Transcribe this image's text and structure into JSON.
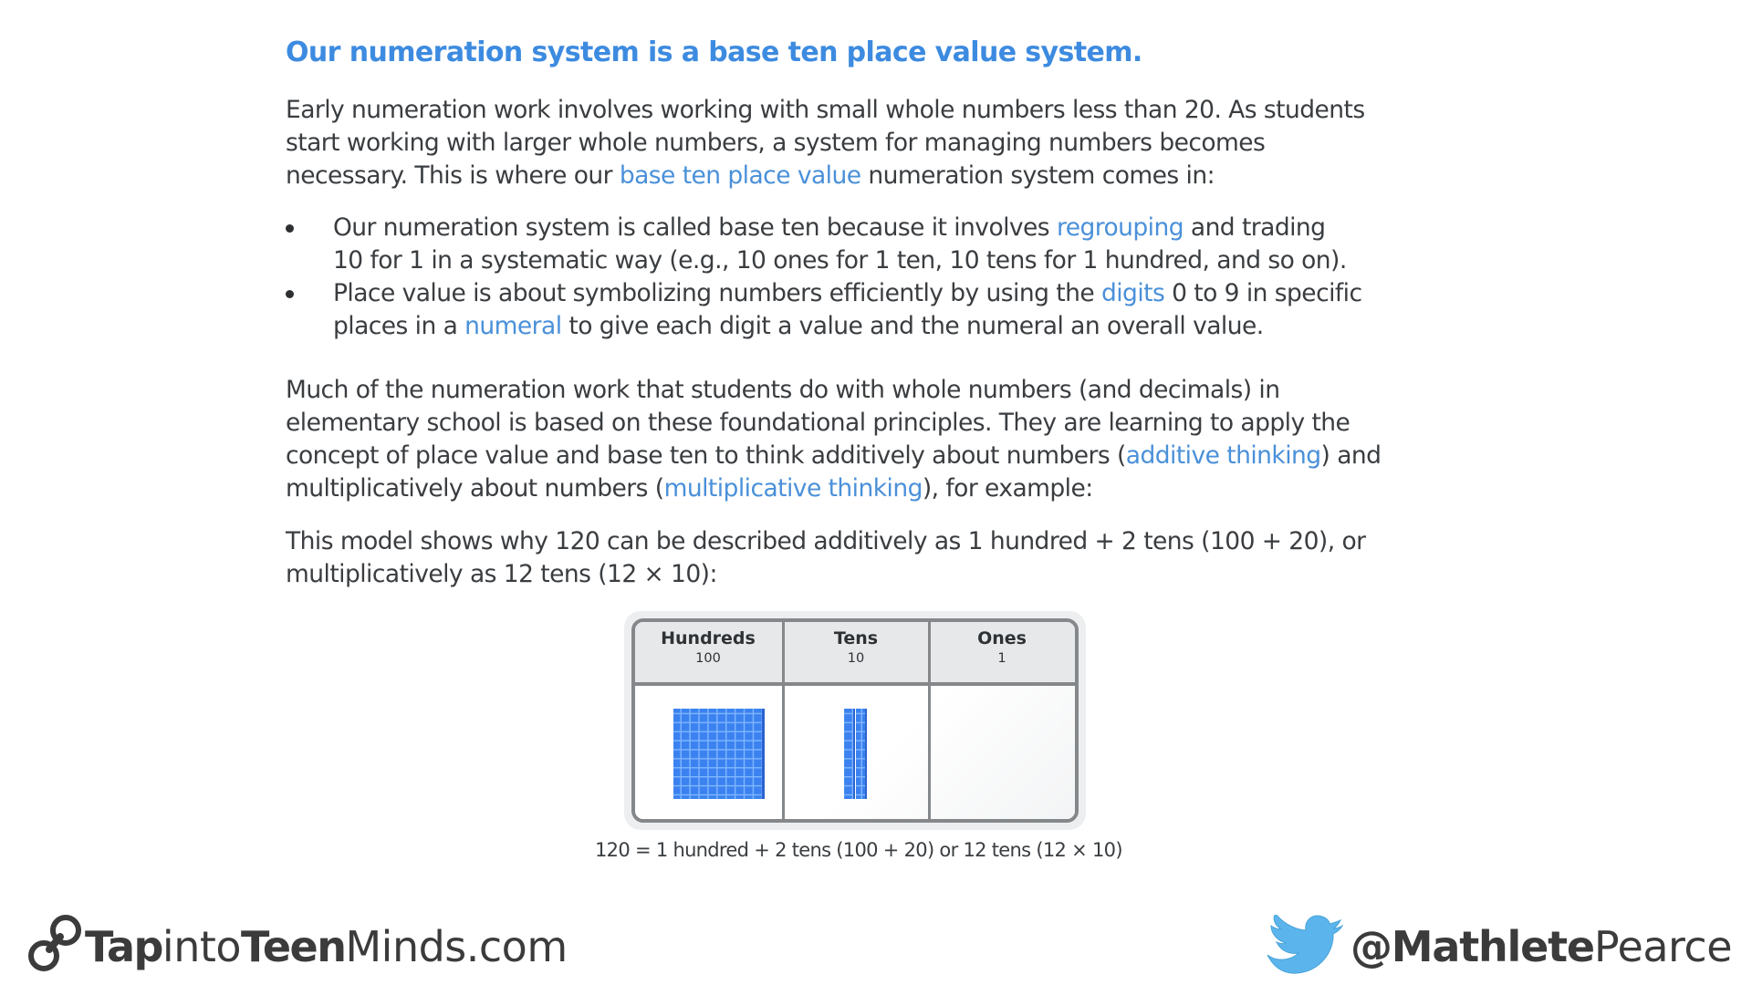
{
  "title": "Our numeration system is a base ten place value system.",
  "colors": {
    "accent": "#3d8be0",
    "link": "#4a90d9",
    "text": "#3a3d40",
    "block_blue": "#3b82f0",
    "twitter": "#5bb5ec"
  },
  "paragraph1": [
    [
      {
        "t": "Early numeration work involves working with small whole numbers less than 20. As students"
      }
    ],
    [
      {
        "t": "start working with larger whole numbers, a system for managing numbers becomes"
      }
    ],
    [
      {
        "t": "necessary. This is where our "
      },
      {
        "t": "base ten place value",
        "link": true
      },
      {
        "t": " numeration system comes in:"
      }
    ]
  ],
  "bullets": [
    [
      [
        {
          "t": "Our numeration system is called base ten because it involves "
        },
        {
          "t": "regrouping",
          "link": true
        },
        {
          "t": " and trading"
        }
      ],
      [
        {
          "t": "10 for 1 in a systematic way (e.g., 10 ones for 1 ten, 10 tens for 1 hundred, and so on)."
        }
      ]
    ],
    [
      [
        {
          "t": "Place value is about symbolizing numbers efficiently by using the "
        },
        {
          "t": "digits",
          "link": true
        },
        {
          "t": " 0 to 9 in specific"
        }
      ],
      [
        {
          "t": "places in a "
        },
        {
          "t": "numeral",
          "link": true
        },
        {
          "t": " to give each digit a value and the numeral an overall value."
        }
      ]
    ]
  ],
  "paragraph2": [
    [
      {
        "t": "Much of the numeration work that students do with whole numbers (and decimals) in"
      }
    ],
    [
      {
        "t": "elementary school is based on these foundational principles. They are learning to apply the"
      }
    ],
    [
      {
        "t": "concept of place value and base ten to think additively about numbers ("
      },
      {
        "t": "additive thinking",
        "link": true
      },
      {
        "t": ") and"
      }
    ],
    [
      {
        "t": "multiplicatively about numbers ("
      },
      {
        "t": "multiplicative thinking",
        "link": true
      },
      {
        "t": "), for example:"
      }
    ]
  ],
  "paragraph3": [
    [
      {
        "t": "This model shows why 120 can be described additively as 1 hundred + 2 tens (100 + 20), or"
      }
    ],
    [
      {
        "t": "multiplicatively as 12 tens (12 × 10):"
      }
    ]
  ],
  "place_value_table": {
    "columns": [
      {
        "name": "Hundreds",
        "value": "100",
        "blocks": 1
      },
      {
        "name": "Tens",
        "value": "10",
        "blocks": 2
      },
      {
        "name": "Ones",
        "value": "1",
        "blocks": 0
      }
    ],
    "caption": "120 = 1 hundred + 2 tens (100 + 20) or 12 tens (12 × 10)"
  },
  "footer": {
    "logo_icon": "chain-link-icon",
    "logo_parts": [
      {
        "t": "Tap",
        "bold": true
      },
      {
        "t": "into",
        "bold": false
      },
      {
        "t": "Teen",
        "bold": true
      },
      {
        "t": "Minds.com",
        "bold": false
      }
    ],
    "social_icon": "twitter-bird-icon",
    "handle_parts": [
      {
        "t": "@Mathlete",
        "bold": true
      },
      {
        "t": "Pearce",
        "bold": false
      }
    ]
  }
}
